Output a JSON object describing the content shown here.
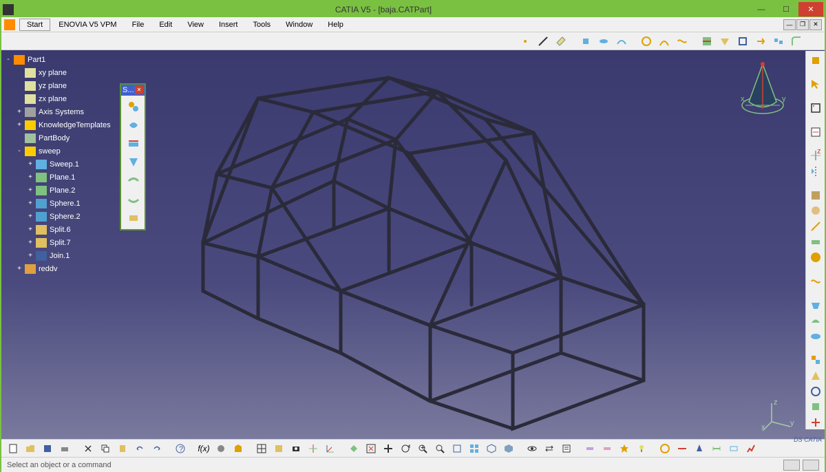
{
  "titlebar": {
    "title": "CATIA V5 - [baja.CATPart]"
  },
  "menubar": {
    "start": "Start",
    "enovia": "ENOVIA V5 VPM",
    "file": "File",
    "edit": "Edit",
    "view": "View",
    "insert": "Insert",
    "tools": "Tools",
    "window": "Window",
    "help": "Help"
  },
  "tree": {
    "root": "Part1",
    "xy": "xy plane",
    "yz": "yz plane",
    "zx": "zx plane",
    "axis": "Axis Systems",
    "knowledge": "KnowledgeTemplates",
    "partbody": "PartBody",
    "sweep": "sweep",
    "sweep1": "Sweep.1",
    "plane1": "Plane.1",
    "plane2": "Plane.2",
    "sphere1": "Sphere.1",
    "sphere2": "Sphere.2",
    "split6": "Split.6",
    "split7": "Split.7",
    "join1": "Join.1",
    "reddv": "reddv"
  },
  "floatingToolbar": {
    "title": "S..."
  },
  "status": {
    "text": "Select an object or a command"
  },
  "logo": "DS CATIA"
}
